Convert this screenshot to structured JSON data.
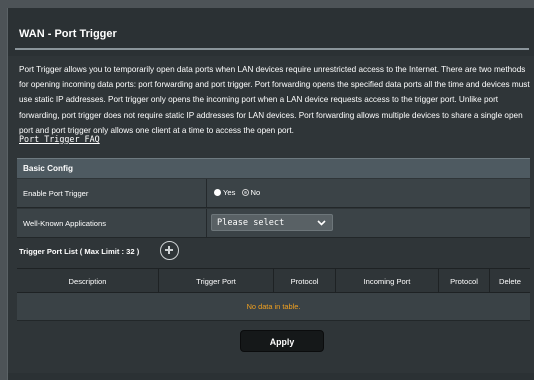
{
  "page": {
    "title": "WAN - Port Trigger",
    "description": "Port Trigger allows you to temporarily open data ports when LAN devices require unrestricted access to the Internet. There are two methods for opening incoming data ports: port forwarding and port trigger. Port forwarding opens the specified data ports all the time and devices must use static IP addresses. Port trigger only opens the incoming port when a LAN device requests access to the trigger port. Unlike port forwarding, port trigger does not require static IP addresses for LAN devices. Port forwarding allows multiple devices to share a single open port and port trigger only allows one client at a time to access the open port.",
    "faq_link": "Port Trigger FAQ"
  },
  "basic_config": {
    "header": "Basic Config",
    "enable_label": "Enable Port Trigger",
    "yes_label": "Yes",
    "no_label": "No",
    "selected": "Yes",
    "apps_label": "Well-Known Applications",
    "apps_value": "Please select"
  },
  "trigger_list": {
    "title": "Trigger Port List ( Max Limit : 32 )",
    "columns": [
      "Description",
      "Trigger Port",
      "Protocol",
      "Incoming Port",
      "Protocol",
      "Delete"
    ],
    "empty_text": "No data in table."
  },
  "actions": {
    "apply": "Apply"
  },
  "icons": {
    "add": "add-circle-icon",
    "dropdown": "chevron-down-icon"
  },
  "colors": {
    "background": "#2f3538",
    "empty_text": "#f0a020",
    "apply_button": "#151819"
  }
}
